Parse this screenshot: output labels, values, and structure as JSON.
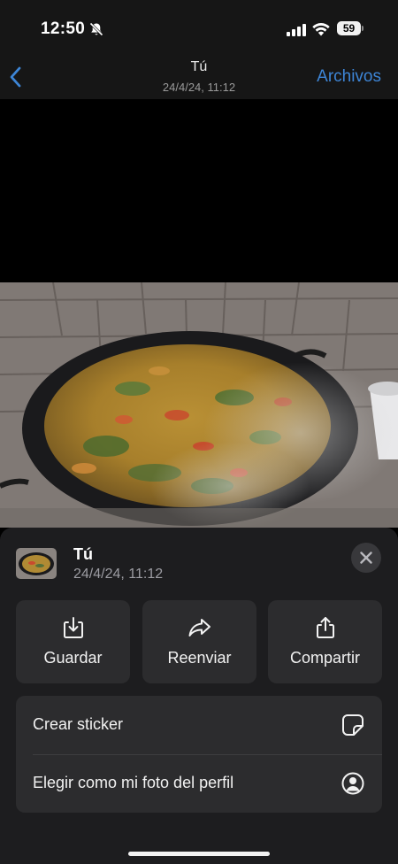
{
  "status_bar": {
    "time": "12:50",
    "battery": "59",
    "icons": [
      "bell-slash-icon",
      "cellular-signal-icon",
      "wifi-icon",
      "battery-icon"
    ]
  },
  "nav": {
    "back_icon": "chevron-left-icon",
    "title": "Tú",
    "subtitle": "24/4/24, 11:12",
    "archivos_label": "Archivos",
    "accent_color": "#3d85d6"
  },
  "photo": {
    "description_icon": "photo-paella"
  },
  "sheet": {
    "title": "Tú",
    "subtitle": "24/4/24, 11:12",
    "close_icon": "close-icon",
    "actions": [
      {
        "label": "Guardar",
        "icon": "download-icon"
      },
      {
        "label": "Reenviar",
        "icon": "forward-arrow-icon"
      },
      {
        "label": "Compartir",
        "icon": "share-icon"
      }
    ],
    "menu": [
      {
        "label": "Crear sticker",
        "icon": "sticker-icon"
      },
      {
        "label": "Elegir como mi foto del perfil",
        "icon": "profile-circle-icon"
      }
    ]
  }
}
